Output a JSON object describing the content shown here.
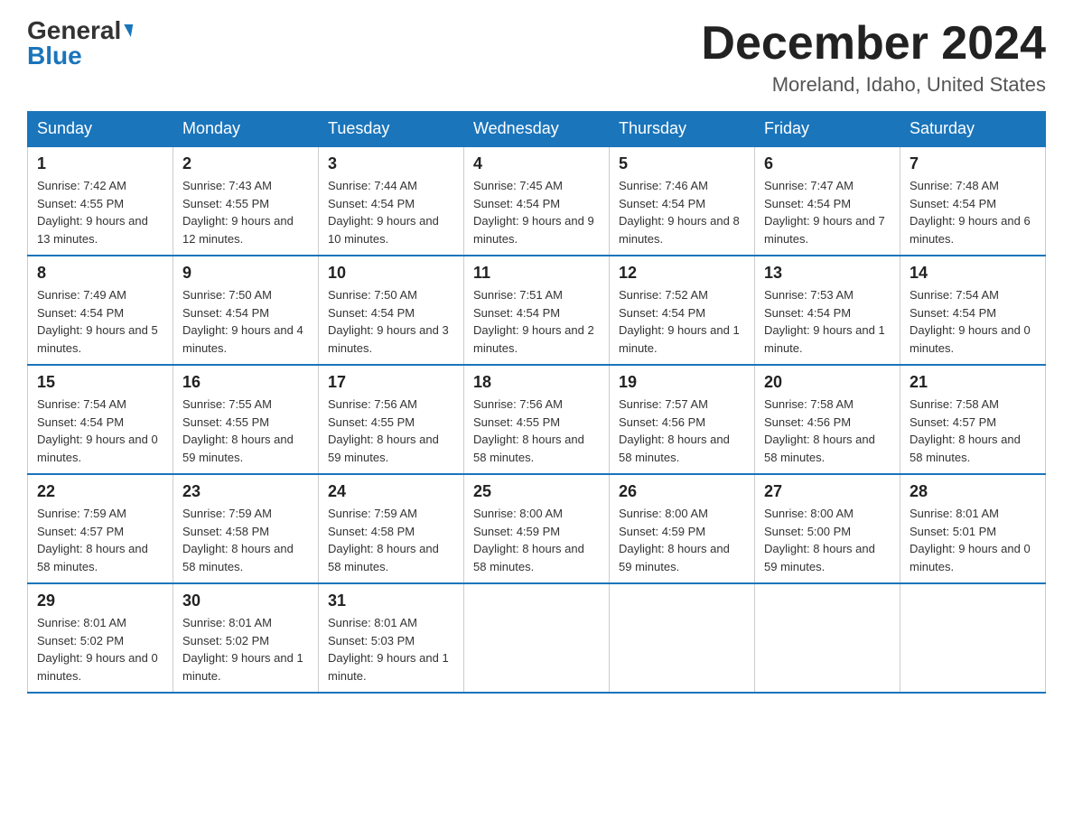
{
  "logo": {
    "general": "General",
    "blue": "Blue"
  },
  "title": "December 2024",
  "location": "Moreland, Idaho, United States",
  "weekdays": [
    "Sunday",
    "Monday",
    "Tuesday",
    "Wednesday",
    "Thursday",
    "Friday",
    "Saturday"
  ],
  "weeks": [
    [
      {
        "day": "1",
        "sunrise": "7:42 AM",
        "sunset": "4:55 PM",
        "daylight": "9 hours and 13 minutes."
      },
      {
        "day": "2",
        "sunrise": "7:43 AM",
        "sunset": "4:55 PM",
        "daylight": "9 hours and 12 minutes."
      },
      {
        "day": "3",
        "sunrise": "7:44 AM",
        "sunset": "4:54 PM",
        "daylight": "9 hours and 10 minutes."
      },
      {
        "day": "4",
        "sunrise": "7:45 AM",
        "sunset": "4:54 PM",
        "daylight": "9 hours and 9 minutes."
      },
      {
        "day": "5",
        "sunrise": "7:46 AM",
        "sunset": "4:54 PM",
        "daylight": "9 hours and 8 minutes."
      },
      {
        "day": "6",
        "sunrise": "7:47 AM",
        "sunset": "4:54 PM",
        "daylight": "9 hours and 7 minutes."
      },
      {
        "day": "7",
        "sunrise": "7:48 AM",
        "sunset": "4:54 PM",
        "daylight": "9 hours and 6 minutes."
      }
    ],
    [
      {
        "day": "8",
        "sunrise": "7:49 AM",
        "sunset": "4:54 PM",
        "daylight": "9 hours and 5 minutes."
      },
      {
        "day": "9",
        "sunrise": "7:50 AM",
        "sunset": "4:54 PM",
        "daylight": "9 hours and 4 minutes."
      },
      {
        "day": "10",
        "sunrise": "7:50 AM",
        "sunset": "4:54 PM",
        "daylight": "9 hours and 3 minutes."
      },
      {
        "day": "11",
        "sunrise": "7:51 AM",
        "sunset": "4:54 PM",
        "daylight": "9 hours and 2 minutes."
      },
      {
        "day": "12",
        "sunrise": "7:52 AM",
        "sunset": "4:54 PM",
        "daylight": "9 hours and 1 minute."
      },
      {
        "day": "13",
        "sunrise": "7:53 AM",
        "sunset": "4:54 PM",
        "daylight": "9 hours and 1 minute."
      },
      {
        "day": "14",
        "sunrise": "7:54 AM",
        "sunset": "4:54 PM",
        "daylight": "9 hours and 0 minutes."
      }
    ],
    [
      {
        "day": "15",
        "sunrise": "7:54 AM",
        "sunset": "4:54 PM",
        "daylight": "9 hours and 0 minutes."
      },
      {
        "day": "16",
        "sunrise": "7:55 AM",
        "sunset": "4:55 PM",
        "daylight": "8 hours and 59 minutes."
      },
      {
        "day": "17",
        "sunrise": "7:56 AM",
        "sunset": "4:55 PM",
        "daylight": "8 hours and 59 minutes."
      },
      {
        "day": "18",
        "sunrise": "7:56 AM",
        "sunset": "4:55 PM",
        "daylight": "8 hours and 58 minutes."
      },
      {
        "day": "19",
        "sunrise": "7:57 AM",
        "sunset": "4:56 PM",
        "daylight": "8 hours and 58 minutes."
      },
      {
        "day": "20",
        "sunrise": "7:58 AM",
        "sunset": "4:56 PM",
        "daylight": "8 hours and 58 minutes."
      },
      {
        "day": "21",
        "sunrise": "7:58 AM",
        "sunset": "4:57 PM",
        "daylight": "8 hours and 58 minutes."
      }
    ],
    [
      {
        "day": "22",
        "sunrise": "7:59 AM",
        "sunset": "4:57 PM",
        "daylight": "8 hours and 58 minutes."
      },
      {
        "day": "23",
        "sunrise": "7:59 AM",
        "sunset": "4:58 PM",
        "daylight": "8 hours and 58 minutes."
      },
      {
        "day": "24",
        "sunrise": "7:59 AM",
        "sunset": "4:58 PM",
        "daylight": "8 hours and 58 minutes."
      },
      {
        "day": "25",
        "sunrise": "8:00 AM",
        "sunset": "4:59 PM",
        "daylight": "8 hours and 58 minutes."
      },
      {
        "day": "26",
        "sunrise": "8:00 AM",
        "sunset": "4:59 PM",
        "daylight": "8 hours and 59 minutes."
      },
      {
        "day": "27",
        "sunrise": "8:00 AM",
        "sunset": "5:00 PM",
        "daylight": "8 hours and 59 minutes."
      },
      {
        "day": "28",
        "sunrise": "8:01 AM",
        "sunset": "5:01 PM",
        "daylight": "9 hours and 0 minutes."
      }
    ],
    [
      {
        "day": "29",
        "sunrise": "8:01 AM",
        "sunset": "5:02 PM",
        "daylight": "9 hours and 0 minutes."
      },
      {
        "day": "30",
        "sunrise": "8:01 AM",
        "sunset": "5:02 PM",
        "daylight": "9 hours and 1 minute."
      },
      {
        "day": "31",
        "sunrise": "8:01 AM",
        "sunset": "5:03 PM",
        "daylight": "9 hours and 1 minute."
      },
      null,
      null,
      null,
      null
    ]
  ]
}
